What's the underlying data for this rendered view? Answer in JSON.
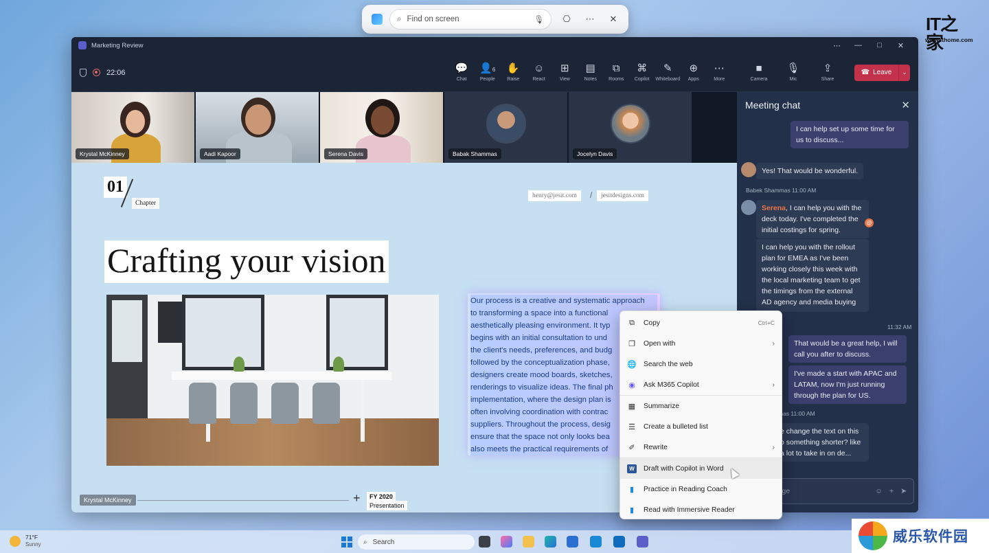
{
  "find_bar": {
    "placeholder": "Find on screen"
  },
  "watermark": {
    "logo": "IT之家",
    "url": "www.ithome.com",
    "bottom_text": "威乐软件园"
  },
  "window": {
    "title": "Marketing Review",
    "controls": [
      "⋯",
      "—",
      "□",
      "✕"
    ]
  },
  "toolbar": {
    "timer": "22:06",
    "buttons": [
      {
        "label": "Chat",
        "icon": "chat-icon",
        "glyph": "💬"
      },
      {
        "label": "People",
        "icon": "people-icon",
        "glyph": "👤",
        "count": "6"
      },
      {
        "label": "Raise",
        "icon": "raise-hand-icon",
        "glyph": "✋"
      },
      {
        "label": "React",
        "icon": "react-icon",
        "glyph": "☺"
      },
      {
        "label": "View",
        "icon": "view-icon",
        "glyph": "⊞"
      },
      {
        "label": "Notes",
        "icon": "notes-icon",
        "glyph": "▤"
      },
      {
        "label": "Rooms",
        "icon": "rooms-icon",
        "glyph": "⧉"
      },
      {
        "label": "Copilot",
        "icon": "copilot-icon",
        "glyph": "⌘"
      },
      {
        "label": "Whiteboard",
        "icon": "whiteboard-icon",
        "glyph": "✎"
      },
      {
        "label": "Apps",
        "icon": "apps-icon",
        "glyph": "⊕"
      },
      {
        "label": "More",
        "icon": "more-icon",
        "glyph": "⋯"
      }
    ],
    "media": [
      {
        "label": "Camera",
        "icon": "camera-icon",
        "glyph": "■"
      },
      {
        "label": "Mic",
        "icon": "mic-icon",
        "glyph": "🎙"
      },
      {
        "label": "Share",
        "icon": "share-icon",
        "glyph": "⇪"
      }
    ],
    "leave_label": "Leave"
  },
  "participants": [
    {
      "name": "Krystal McKinney"
    },
    {
      "name": "Aadi Kapoor"
    },
    {
      "name": "Serena Davis"
    },
    {
      "name": "Babak Shammas"
    },
    {
      "name": "Jocelyn Davis"
    }
  ],
  "slide": {
    "chapter_number": "01",
    "chapter_label": "Chapter",
    "email": "henry@jesit.com",
    "website": "jesitdesigns.com",
    "title": "Crafting your vision",
    "paragraph_lines": [
      "Our process is a creative and systematic approach",
      "to transforming a space into a functional",
      "aesthetically pleasing environment. It typ",
      "begins with an initial consultation to und",
      "the client's needs, preferences, and budg",
      "followed by the conceptualization phase,",
      "designers create mood boards, sketches,",
      "renderings to visualize ideas. The final ph",
      "implementation, where the design plan is",
      "often involving coordination with contrac",
      "suppliers. Throughout the process, desig",
      "ensure that the space not only looks bea",
      "also meets the practical requirements of"
    ],
    "presenter": "Krystal McKinney",
    "fy": "FY 2020",
    "fy_sub": "Presentation"
  },
  "chat": {
    "title": "Meeting chat",
    "messages": {
      "m1": "I can help set up some time for us to discuss...",
      "m2": "Yes! That would be wonderful.",
      "meta1": "Babek Shammas   11:00 AM",
      "m3_mention": "Serena",
      "m3_rest1": ", I can help you with the",
      "m3_rest2": "deck today. I've completed the",
      "m3_rest3": "initial costings for spring.",
      "m4": "I can help you with the rollout plan for EMEA as I've been working closely this week with the local marketing team to get the timings from the external AD agency and media buying",
      "meta2": "11:32 AM",
      "m5": "That would be a great help, I will call you after to discuss.",
      "m6": "I've made a start with APAC and LATAM, now I'm just running through the plan for US.",
      "meta3": "mas   11:00 AM",
      "m7": "e change the text on this o something shorter? like a lot to take in on de..."
    },
    "compose_placeholder": "w message"
  },
  "context_menu": [
    {
      "label": "Copy",
      "shortcut": "Ctrl+C",
      "icon": "copy-icon",
      "glyph": "⧉"
    },
    {
      "label": "Open with",
      "arrow": "›",
      "icon": "open-with-icon",
      "glyph": "❐"
    },
    {
      "label": "Search the web",
      "icon": "globe-icon",
      "glyph": "🌐"
    },
    {
      "label": "Ask M365 Copilot",
      "arrow": "›",
      "icon": "m365-copilot-icon",
      "glyph": "◉"
    },
    {
      "label": "Summarize",
      "icon": "summarize-icon",
      "glyph": "▦"
    },
    {
      "label": "Create a bulleted list",
      "icon": "bulleted-list-icon",
      "glyph": "☰"
    },
    {
      "label": "Rewrite",
      "arrow": "›",
      "icon": "rewrite-icon",
      "glyph": "✐"
    },
    {
      "label": "Draft with Copilot in Word",
      "icon": "word-icon",
      "glyph": "W"
    },
    {
      "label": "Practice in Reading Coach",
      "icon": "reading-coach-icon",
      "glyph": "▮"
    },
    {
      "label": "Read with Immersive Reader",
      "icon": "immersive-reader-icon",
      "glyph": "▮"
    }
  ],
  "taskbar": {
    "weather_temp": "71°F",
    "weather_desc": "Sunny",
    "search_label": "Search"
  },
  "colors": {
    "leave": "#c4314b",
    "slide_bg": "#c6e0f2",
    "chat_bg": "#223049",
    "accent_mention": "#e97548"
  }
}
